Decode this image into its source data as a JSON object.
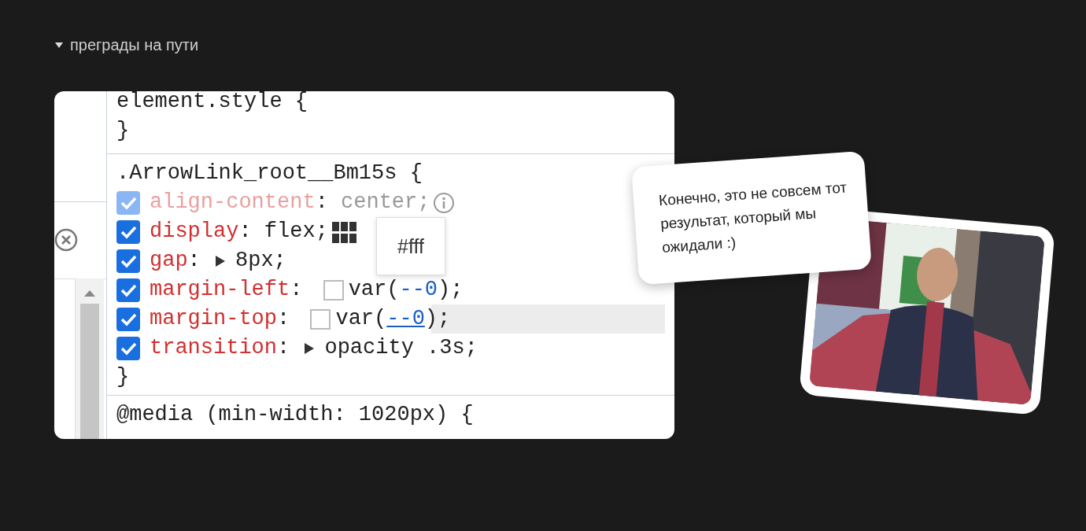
{
  "section": {
    "title": "преграды на пути",
    "expanded": true
  },
  "devtools": {
    "element_style": {
      "selector": "element.style {",
      "close": "}"
    },
    "rule": {
      "selector": ".ArrowLink_root__Bm15s {",
      "close": "}",
      "declarations": [
        {
          "property": "align-content",
          "separator": ": ",
          "value": "center;",
          "checked": true,
          "inactive": true,
          "kind": "info"
        },
        {
          "property": "display",
          "separator": ": ",
          "value": "flex;",
          "checked": true,
          "inactive": false,
          "kind": "grid"
        },
        {
          "property": "gap",
          "separator": ": ",
          "value": "8px;",
          "checked": true,
          "inactive": false,
          "kind": "expand"
        },
        {
          "property": "margin-left",
          "separator": ": ",
          "value": "var(",
          "var_name": "--0",
          "value_end": ");",
          "checked": true,
          "inactive": false,
          "kind": "swatch"
        },
        {
          "property": "margin-top",
          "separator": ": ",
          "value": "var(",
          "var_name": "--0",
          "value_end": ");",
          "checked": true,
          "inactive": false,
          "kind": "swatch",
          "hovered": true
        },
        {
          "property": "transition",
          "separator": ": ",
          "value": "opacity .3s;",
          "checked": true,
          "inactive": false,
          "kind": "expand"
        }
      ]
    },
    "media": "@media (min-width: 1020px) {",
    "tooltip": "#fff"
  },
  "comment": "Конечно, это не совсем тот результат, который мы ожидали :)"
}
